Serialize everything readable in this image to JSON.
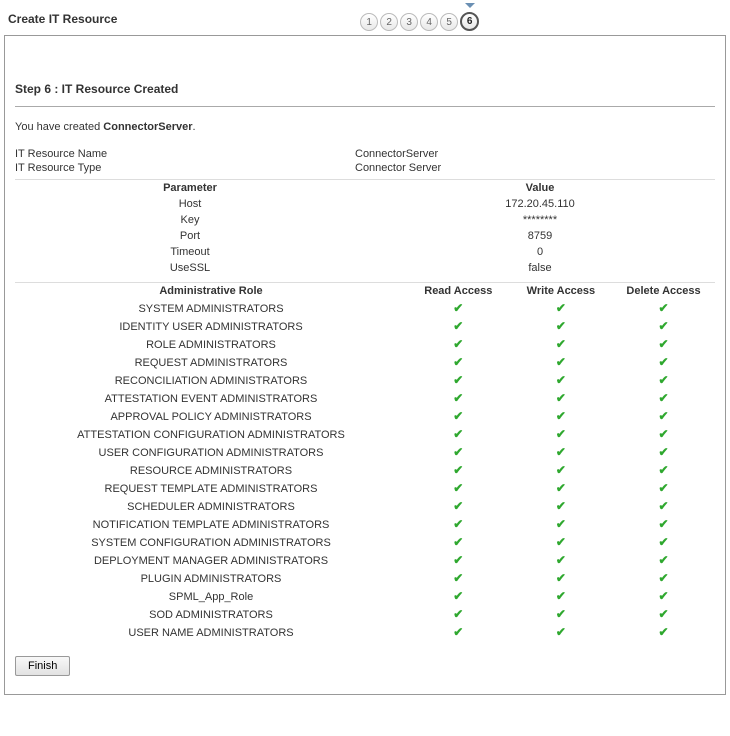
{
  "title": "Create IT Resource",
  "steps": [
    "1",
    "2",
    "3",
    "4",
    "5",
    "6"
  ],
  "currentStep": 6,
  "stepHeading": "Step 6 : IT Resource Created",
  "createdMsg_prefix": "You have created ",
  "createdMsg_name": "ConnectorServer",
  "createdMsg_suffix": ".",
  "details": [
    {
      "label": "IT Resource Name",
      "value": "ConnectorServer"
    },
    {
      "label": "IT Resource Type",
      "value": "Connector Server"
    }
  ],
  "paramHeader": {
    "name": "Parameter",
    "value": "Value"
  },
  "params": [
    {
      "name": "Host",
      "value": "172.20.45.110"
    },
    {
      "name": "Key",
      "value": "********"
    },
    {
      "name": "Port",
      "value": "8759"
    },
    {
      "name": "Timeout",
      "value": "0"
    },
    {
      "name": "UseSSL",
      "value": "false"
    }
  ],
  "rolesHeader": {
    "role": "Administrative Role",
    "read": "Read Access",
    "write": "Write Access",
    "del": "Delete Access"
  },
  "roles": [
    {
      "name": "SYSTEM ADMINISTRATORS",
      "read": true,
      "write": true,
      "del": true
    },
    {
      "name": "IDENTITY USER ADMINISTRATORS",
      "read": true,
      "write": true,
      "del": true
    },
    {
      "name": "ROLE ADMINISTRATORS",
      "read": true,
      "write": true,
      "del": true
    },
    {
      "name": "REQUEST ADMINISTRATORS",
      "read": true,
      "write": true,
      "del": true
    },
    {
      "name": "RECONCILIATION ADMINISTRATORS",
      "read": true,
      "write": true,
      "del": true
    },
    {
      "name": "ATTESTATION EVENT ADMINISTRATORS",
      "read": true,
      "write": true,
      "del": true
    },
    {
      "name": "APPROVAL POLICY ADMINISTRATORS",
      "read": true,
      "write": true,
      "del": true
    },
    {
      "name": "ATTESTATION CONFIGURATION ADMINISTRATORS",
      "read": true,
      "write": true,
      "del": true
    },
    {
      "name": "USER CONFIGURATION ADMINISTRATORS",
      "read": true,
      "write": true,
      "del": true
    },
    {
      "name": "RESOURCE ADMINISTRATORS",
      "read": true,
      "write": true,
      "del": true
    },
    {
      "name": "REQUEST TEMPLATE ADMINISTRATORS",
      "read": true,
      "write": true,
      "del": true
    },
    {
      "name": "SCHEDULER ADMINISTRATORS",
      "read": true,
      "write": true,
      "del": true
    },
    {
      "name": "NOTIFICATION TEMPLATE ADMINISTRATORS",
      "read": true,
      "write": true,
      "del": true
    },
    {
      "name": "SYSTEM CONFIGURATION ADMINISTRATORS",
      "read": true,
      "write": true,
      "del": true
    },
    {
      "name": "DEPLOYMENT MANAGER ADMINISTRATORS",
      "read": true,
      "write": true,
      "del": true
    },
    {
      "name": "PLUGIN ADMINISTRATORS",
      "read": true,
      "write": true,
      "del": true
    },
    {
      "name": "SPML_App_Role",
      "read": true,
      "write": true,
      "del": true
    },
    {
      "name": "SOD ADMINISTRATORS",
      "read": true,
      "write": true,
      "del": true
    },
    {
      "name": "USER NAME ADMINISTRATORS",
      "read": true,
      "write": true,
      "del": true
    }
  ],
  "finishLabel": "Finish"
}
